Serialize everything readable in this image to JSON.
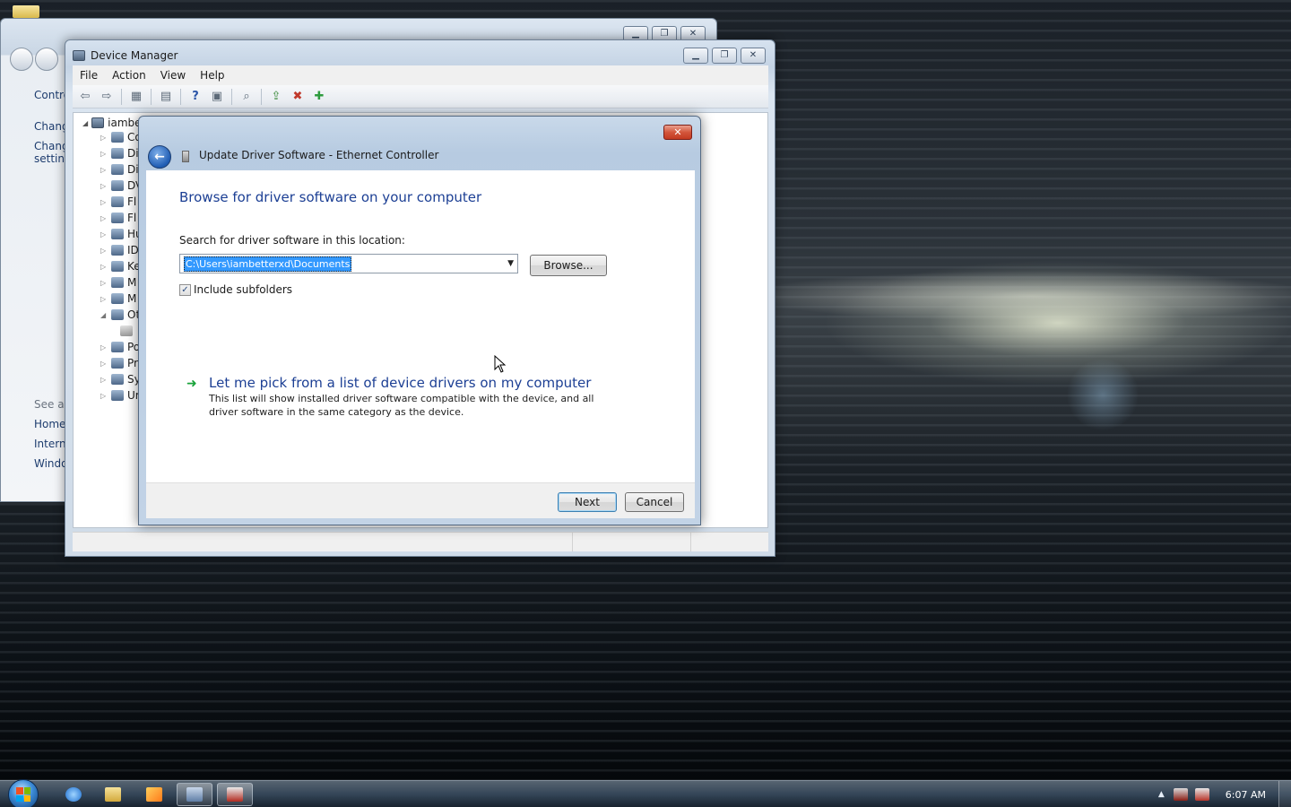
{
  "control_panel": {
    "sidebar": [
      {
        "label": "Contro",
        "muted": false
      },
      {
        "label": "Chang",
        "muted": false
      },
      {
        "label": "Chang",
        "muted": false
      },
      {
        "label": "setting",
        "muted": false
      },
      {
        "label": "See als",
        "muted": true
      },
      {
        "label": "Home",
        "muted": false
      },
      {
        "label": "Interne",
        "muted": false
      },
      {
        "label": "Windo",
        "muted": false
      }
    ]
  },
  "device_manager": {
    "title": "Device Manager",
    "menu": [
      "File",
      "Action",
      "View",
      "Help"
    ],
    "tree": {
      "root": "iambe",
      "items": [
        "Co",
        "Di",
        "Di",
        "DV",
        "Fl",
        "Fl",
        "Hu",
        "ID",
        "Ke",
        "M",
        "M",
        "Ot",
        "",
        "Po",
        "Pr",
        "Sy",
        "Ur"
      ]
    }
  },
  "wizard": {
    "title": "Update Driver Software - Ethernet Controller",
    "heading": "Browse for driver software on your computer",
    "search_label": "Search for driver software in this location:",
    "path_value": "C:\\Users\\iambetterxd\\Documents",
    "browse_label": "Browse...",
    "include_subfolders_label": "Include subfolders",
    "include_subfolders_checked": true,
    "pick_title": "Let me pick from a list of device drivers on my computer",
    "pick_desc": "This list will show installed driver software compatible with the device, and all driver software in the same category as the device.",
    "next_label": "Next",
    "cancel_label": "Cancel"
  },
  "taskbar": {
    "items": [
      "internet-explorer",
      "windows-explorer",
      "media-player",
      "device-manager",
      "update-driver"
    ],
    "clock": "6:07 AM"
  },
  "colors": {
    "link_blue": "#1c3f94",
    "selection_blue": "#3399ff",
    "close_red": "#c23a20"
  }
}
